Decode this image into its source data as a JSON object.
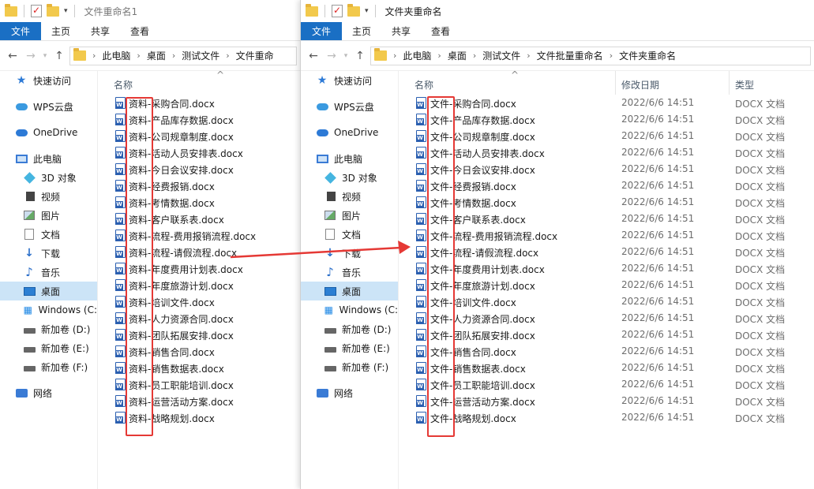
{
  "windows": {
    "left": {
      "title": "文件重命名1",
      "tabs": [
        "文件",
        "主页",
        "共享",
        "查看"
      ],
      "breadcrumb": [
        "此电脑",
        "桌面",
        "测试文件",
        "文件重命"
      ],
      "column_name": "名称",
      "files": [
        "资料-采购合同.docx",
        "资料-产品库存数据.docx",
        "资料-公司规章制度.docx",
        "资料-活动人员安排表.docx",
        "资料-今日会议安排.docx",
        "资料-经费报销.docx",
        "资料-考情数据.docx",
        "资料-客户联系表.docx",
        "资料-流程-费用报销流程.docx",
        "资料-流程-请假流程.docx",
        "资料-年度费用计划表.docx",
        "资料-年度旅游计划.docx",
        "资料-培训文件.docx",
        "资料-人力资源合同.docx",
        "资料-团队拓展安排.docx",
        "资料-销售合同.docx",
        "资料-销售数据表.docx",
        "资料-员工职能培训.docx",
        "资料-运营活动方案.docx",
        "资料-战略规划.docx"
      ]
    },
    "right": {
      "title": "文件夹重命名",
      "tabs": [
        "文件",
        "主页",
        "共享",
        "查看"
      ],
      "breadcrumb": [
        "此电脑",
        "桌面",
        "测试文件",
        "文件批量重命名",
        "文件夹重命名"
      ],
      "column_name": "名称",
      "column_date": "修改日期",
      "column_type": "类型",
      "file_date": "2022/6/6 14:51",
      "file_type": "DOCX 文档",
      "files": [
        "文件-采购合同.docx",
        "文件-产品库存数据.docx",
        "文件-公司规章制度.docx",
        "文件-活动人员安排表.docx",
        "文件-今日会议安排.docx",
        "文件-经费报销.docx",
        "文件-考情数据.docx",
        "文件-客户联系表.docx",
        "文件-流程-费用报销流程.docx",
        "文件-流程-请假流程.docx",
        "文件-年度费用计划表.docx",
        "文件-年度旅游计划.docx",
        "文件-培训文件.docx",
        "文件-人力资源合同.docx",
        "文件-团队拓展安排.docx",
        "文件-销售合同.docx",
        "文件-销售数据表.docx",
        "文件-员工职能培训.docx",
        "文件-运营活动方案.docx",
        "文件-战略规划.docx"
      ]
    }
  },
  "nav": [
    {
      "label": "快速访问",
      "icon": "star-icon"
    },
    {
      "label": "WPS云盘",
      "icon": "wps-cloud-icon"
    },
    {
      "label": "OneDrive",
      "icon": "onedrive-icon"
    },
    {
      "label": "此电脑",
      "icon": "pc-icon"
    },
    {
      "label": "3D 对象",
      "icon": "3d-objects-icon"
    },
    {
      "label": "视频",
      "icon": "video-icon"
    },
    {
      "label": "图片",
      "icon": "pictures-icon"
    },
    {
      "label": "文档",
      "icon": "documents-icon"
    },
    {
      "label": "下载",
      "icon": "download-icon"
    },
    {
      "label": "音乐",
      "icon": "music-icon"
    },
    {
      "label": "桌面",
      "icon": "desktop-icon"
    },
    {
      "label": "Windows (C:",
      "icon": "windows-drive-icon"
    },
    {
      "label": "新加卷 (D:)",
      "icon": "drive-icon"
    },
    {
      "label": "新加卷 (E:)",
      "icon": "drive-icon"
    },
    {
      "label": "新加卷 (F:)",
      "icon": "drive-icon"
    },
    {
      "label": "网络",
      "icon": "network-icon"
    }
  ],
  "colors": {
    "ribbon_file_tab": "#1a6fc4",
    "selected_nav": "#cce4f7",
    "highlight_box": "#e53935",
    "word_icon": "#2b5fb0"
  }
}
